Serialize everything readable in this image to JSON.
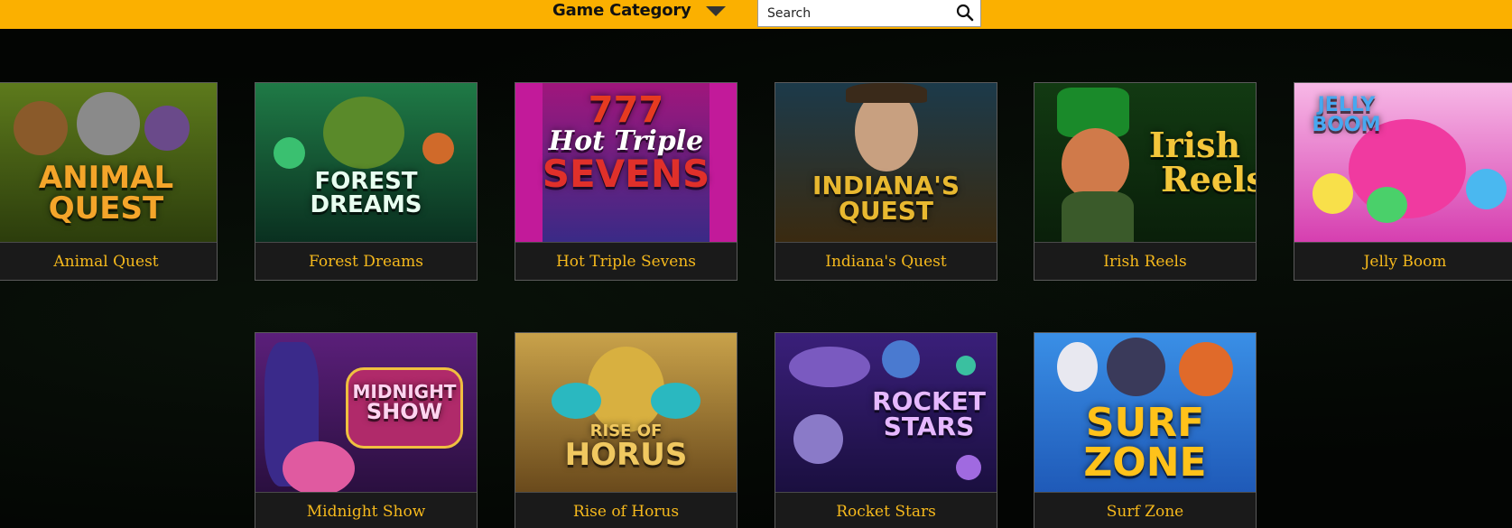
{
  "header": {
    "category_label": "Game Category",
    "search_placeholder": "Search"
  },
  "games": [
    {
      "title": "Animal Quest",
      "logo_lines": [
        "ANIMAL",
        "QUEST"
      ],
      "bg_top": "#5d7a1c",
      "bg_bottom": "#2c3d0c",
      "logo_color": "#f4a52a"
    },
    {
      "title": "Forest Dreams",
      "logo_lines": [
        "FOREST DREAMS"
      ],
      "bg_top": "#1f7a46",
      "bg_bottom": "#0a3020",
      "logo_color": "#e8fff0"
    },
    {
      "title": "Hot Triple Sevens",
      "logo_lines": [
        "777",
        "Hot Triple",
        "SEVENS"
      ],
      "bg_top": "#a0167c",
      "bg_bottom": "#3a2a86",
      "logo_color": "#ffd400"
    },
    {
      "title": "Indiana's Quest",
      "logo_lines": [
        "INDIANA'S",
        "QUEST"
      ],
      "bg_top": "#1c3a4a",
      "bg_bottom": "#3a2a10",
      "logo_color": "#e8b830"
    },
    {
      "title": "Irish Reels",
      "logo_lines": [
        "Irish",
        "Reels"
      ],
      "bg_top": "#123a12",
      "bg_bottom": "#0a1f0a",
      "logo_color": "#f3c63a"
    },
    {
      "title": "Jelly Boom",
      "logo_lines": [
        "JELLY",
        "BOOM"
      ],
      "bg_top": "#f7b8e6",
      "bg_bottom": "#d63fb0",
      "logo_color": "#47a8f0"
    },
    {
      "title": "Midnight Show",
      "logo_lines": [
        "MIDNIGHT",
        "SHOW"
      ],
      "bg_top": "#5b1f7a",
      "bg_bottom": "#2a0f3f",
      "logo_color": "#ffd4f0"
    },
    {
      "title": "Rise of Horus",
      "logo_lines": [
        "RISE OF",
        "HORUS"
      ],
      "bg_top": "#c9a24a",
      "bg_bottom": "#6a4a1c",
      "logo_color": "#f0c860"
    },
    {
      "title": "Rocket Stars",
      "logo_lines": [
        "ROCKET",
        "STARS"
      ],
      "bg_top": "#3a1f7a",
      "bg_bottom": "#1a0f3f",
      "logo_color": "#e6b8ff"
    },
    {
      "title": "Surf Zone",
      "logo_lines": [
        "SURF",
        "ZONE"
      ],
      "bg_top": "#3a8fe6",
      "bg_bottom": "#1f5ab8",
      "logo_color": "#ffc21a"
    }
  ],
  "icons": {
    "search": "search-icon",
    "dropdown": "chevron-down-icon"
  }
}
